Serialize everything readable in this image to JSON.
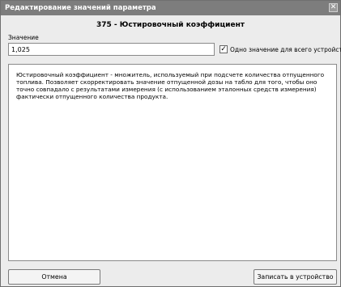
{
  "window": {
    "title": "Редактирование значений параметра",
    "close_glyph": "✕"
  },
  "param": {
    "title": "375 - Юстировочный коэффициент"
  },
  "value": {
    "label": "Значение",
    "input_value": "1,025"
  },
  "checkbox": {
    "checked_glyph": "✓",
    "label": "Одно значение для всего устройства"
  },
  "description": "Юстировочный коэффициент - множитель, используемый при подсчете количества отпущенного топлива. Позволяет скорректировать значение отпущенной дозы на табло для того, чтобы оно точно совпадало с результатами измерения (с использованием эталонных средств измерения) фактически отпущенного количества продукта.",
  "buttons": {
    "cancel": "Отмена",
    "write": "Записать в устройство"
  }
}
